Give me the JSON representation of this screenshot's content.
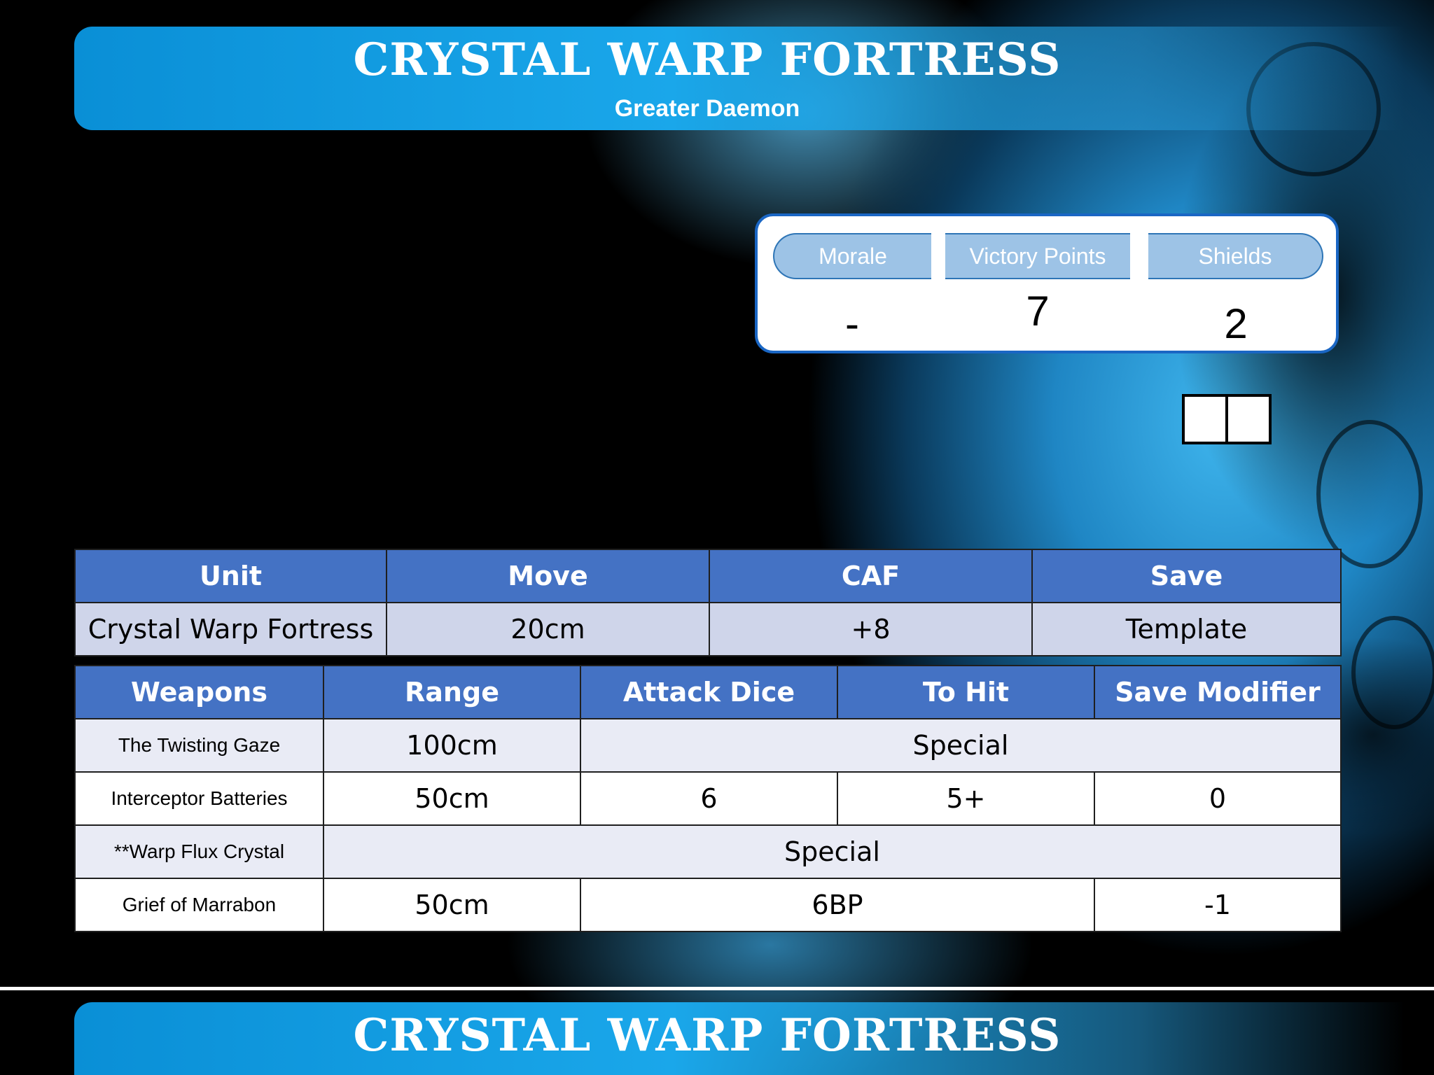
{
  "header": {
    "title": "CRYSTAL WARP FORTRESS",
    "subtitle": "Greater Daemon"
  },
  "stats": {
    "labels": [
      "Morale",
      "Victory Points",
      "Shields"
    ],
    "values": [
      "-",
      "7",
      "2"
    ]
  },
  "unit_table": {
    "headers": [
      "Unit",
      "Move",
      "CAF",
      "Save"
    ],
    "row": [
      "Crystal Warp Fortress",
      "20cm",
      "+8",
      "Template"
    ]
  },
  "weapons_table": {
    "headers": [
      "Weapons",
      "Range",
      "Attack Dice",
      "To Hit",
      "Save Modifier"
    ],
    "rows": [
      {
        "name": "The Twisting Gaze",
        "range": "100cm",
        "merged": "Special"
      },
      {
        "name": "Interceptor Batteries",
        "range": "50cm",
        "attack_dice": "6",
        "to_hit": "5+",
        "save_modifier": "0"
      },
      {
        "name": "**Warp Flux Crystal",
        "merged": "Special"
      },
      {
        "name": "Grief of Marrabon",
        "range": "50cm",
        "attack_to_hit": "6BP",
        "save_modifier": "-1"
      }
    ]
  },
  "footer": {
    "title": "CRYSTAL WARP FORTRESS"
  },
  "colors": {
    "banner": "#1aa7ea",
    "table_header": "#4472c4",
    "unit_row": "#cfd5ea",
    "stat_header": "#9dc3e6",
    "stat_border": "#1a66c4"
  }
}
